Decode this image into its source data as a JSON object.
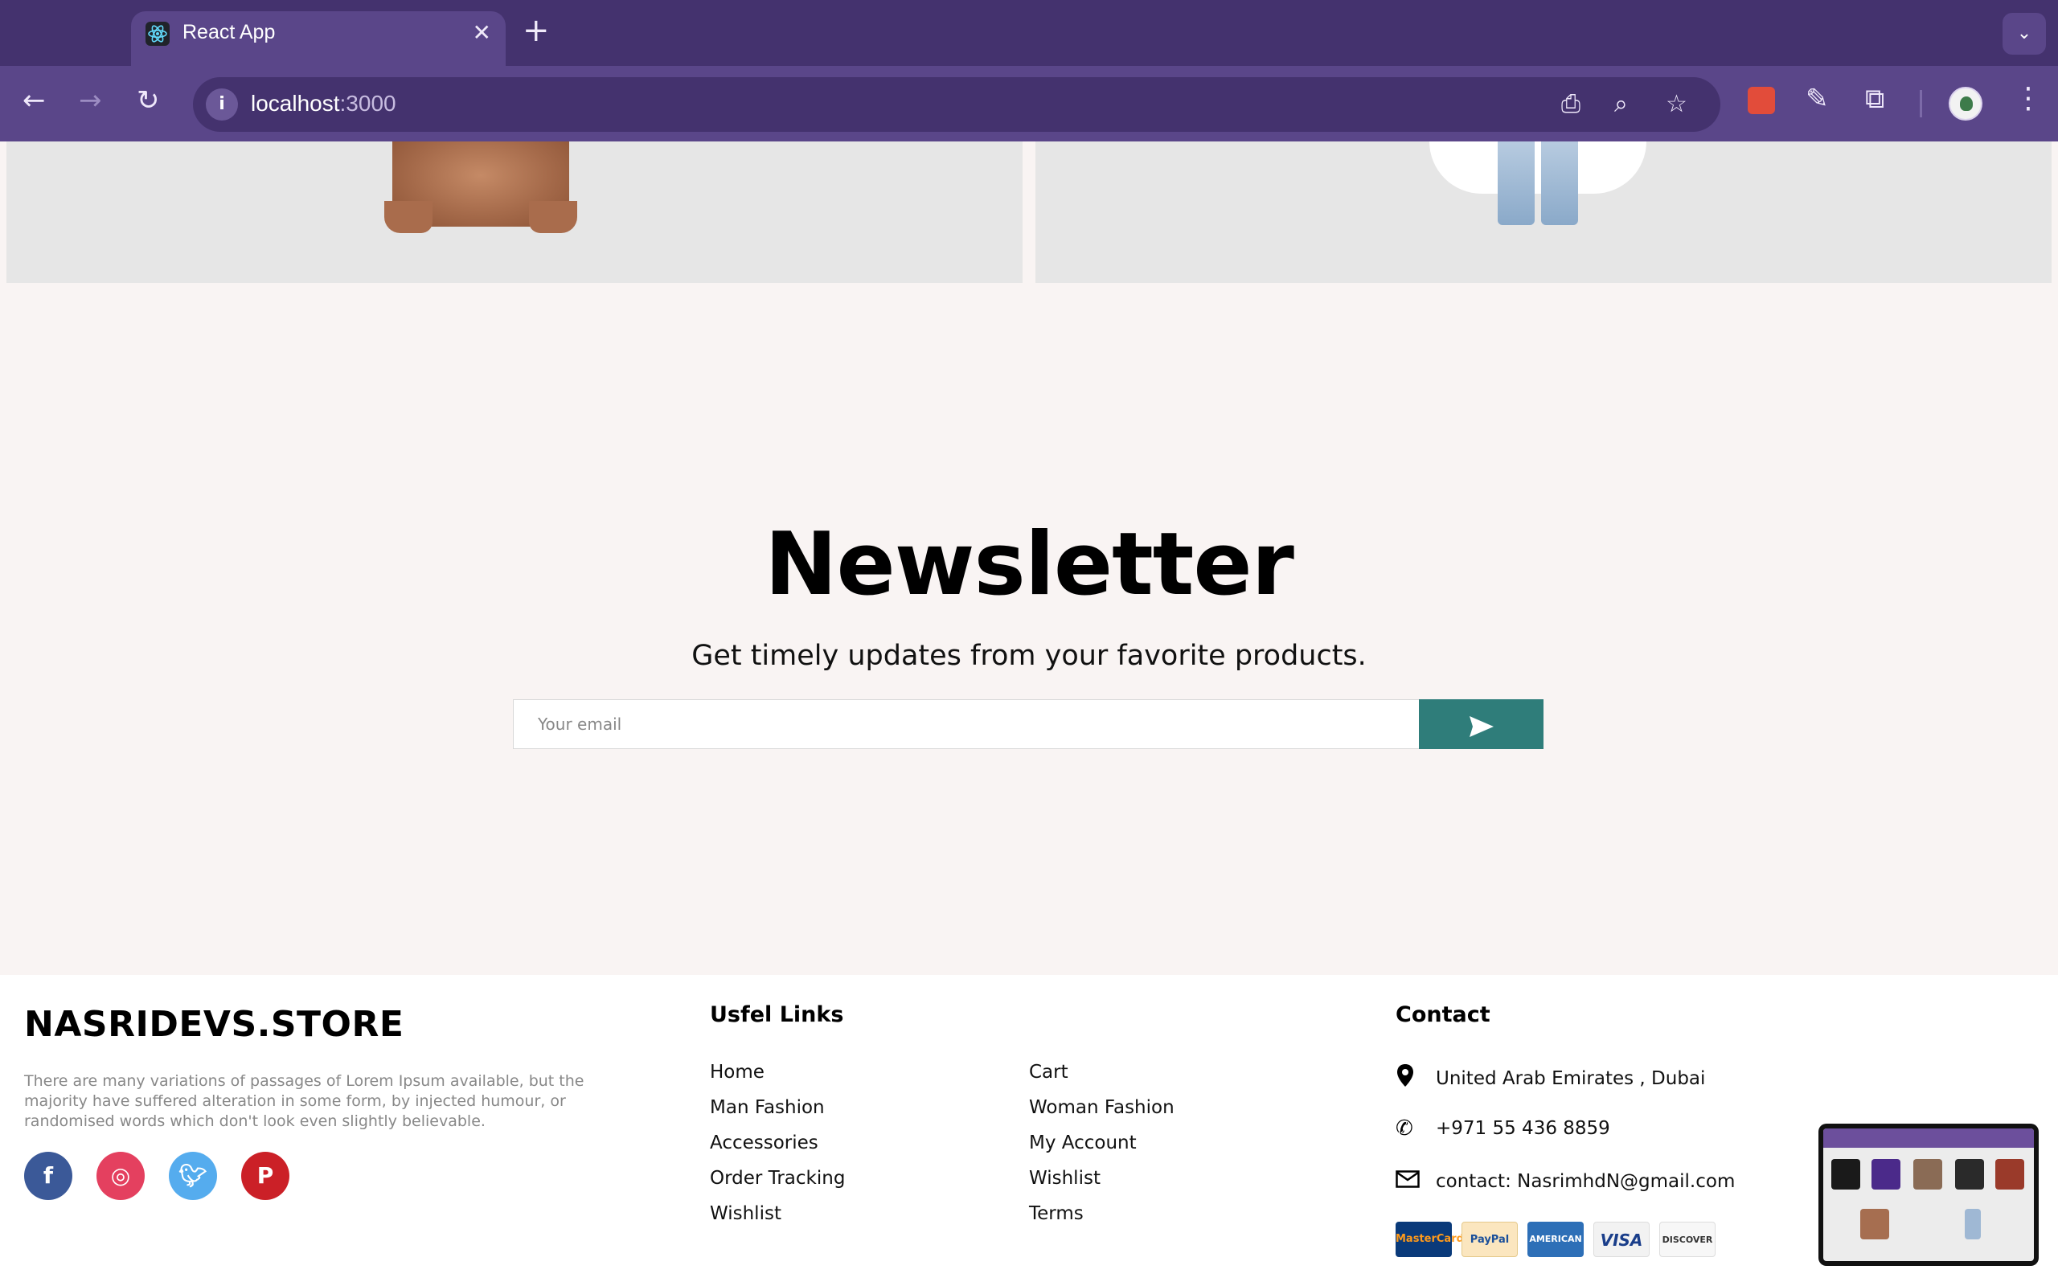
{
  "browser": {
    "tab_title": "React App",
    "url_host": "localhost",
    "url_port": ":3000",
    "new_tab": "+",
    "close": "✕"
  },
  "newsletter": {
    "title": "Newsletter",
    "subtitle": "Get timely updates from your favorite products.",
    "email_placeholder": "Your email"
  },
  "footer": {
    "brand": "NASRIDEVS.STORE",
    "about": "There are many variations of passages of Lorem Ipsum available, but the majority have suffered alteration in some form, by injected humour, or randomised words which don't look even slightly believable.",
    "links_title": "Usfel Links",
    "links_col1": [
      "Home",
      "Man Fashion",
      "Accessories",
      "Order Tracking",
      "Wishlist"
    ],
    "links_col2": [
      "Cart",
      "Woman Fashion",
      "My Account",
      "Wishlist",
      "Terms"
    ],
    "contact_title": "Contact",
    "address": "United Arab Emirates , Dubai",
    "phone": "+971 55 436 8859",
    "email": "contact: NasrimhdN@gmail.com",
    "payments": [
      "MasterCard",
      "PayPal",
      "AMERICAN EXPRESS",
      "VISA",
      "DISCOVER"
    ]
  },
  "colors": {
    "accent": "#2f7d7a",
    "browser_frame": "#44326e",
    "page_bg": "#f9f4f3"
  }
}
